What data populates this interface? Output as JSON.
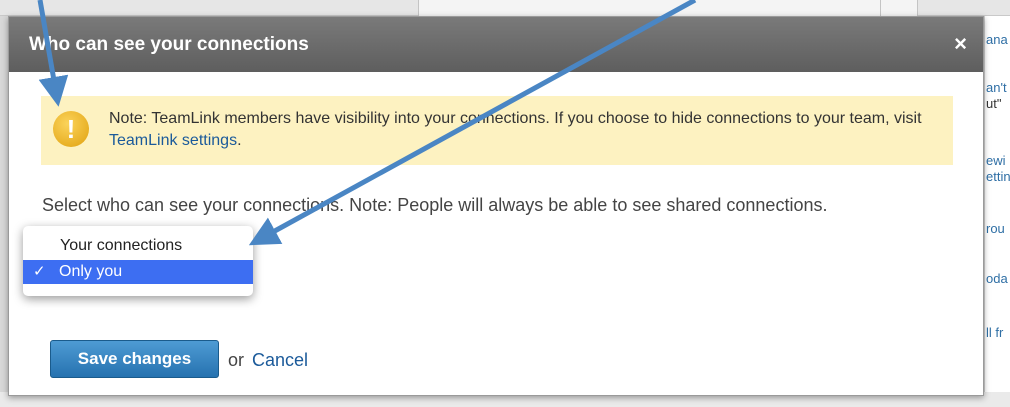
{
  "background": {
    "right_snippets": [
      {
        "text": "ana",
        "kind": "lnk"
      },
      {
        "text": "an't",
        "kind": "lnk"
      },
      {
        "text": "ut\" ",
        "kind": "lnk"
      },
      {
        "text": "ewi",
        "kind": "lnk"
      },
      {
        "text": "ettin",
        "kind": "lnk"
      },
      {
        "text": "rou",
        "kind": "lnk"
      },
      {
        "text": "oda",
        "kind": "lnk"
      },
      {
        "text": "ll fr",
        "kind": "lnk"
      }
    ]
  },
  "modal": {
    "title": "Who can see your connections",
    "close_label": "×",
    "notice": {
      "icon_glyph": "!",
      "text_before": "Note: TeamLink members have visibility into your connections. If you choose to hide connections to your team, visit ",
      "link": "TeamLink settings",
      "text_after": "."
    },
    "select_description": "Select who can see your connections. Note: People will always be able to see shared connections.",
    "dropdown": {
      "options": [
        "Your connections",
        "Only you"
      ],
      "selected": "Only you",
      "check_glyph": "✓"
    },
    "save_label": "Save changes",
    "or_text": "or",
    "cancel_label": "Cancel"
  },
  "colors": {
    "header": "#6b6b6b",
    "notice_bg": "#fdf2c1",
    "link": "#1b5a9a",
    "dropdown_highlight": "#3d6ef2",
    "button": "#2672b0",
    "arrow": "#4a86c4"
  }
}
